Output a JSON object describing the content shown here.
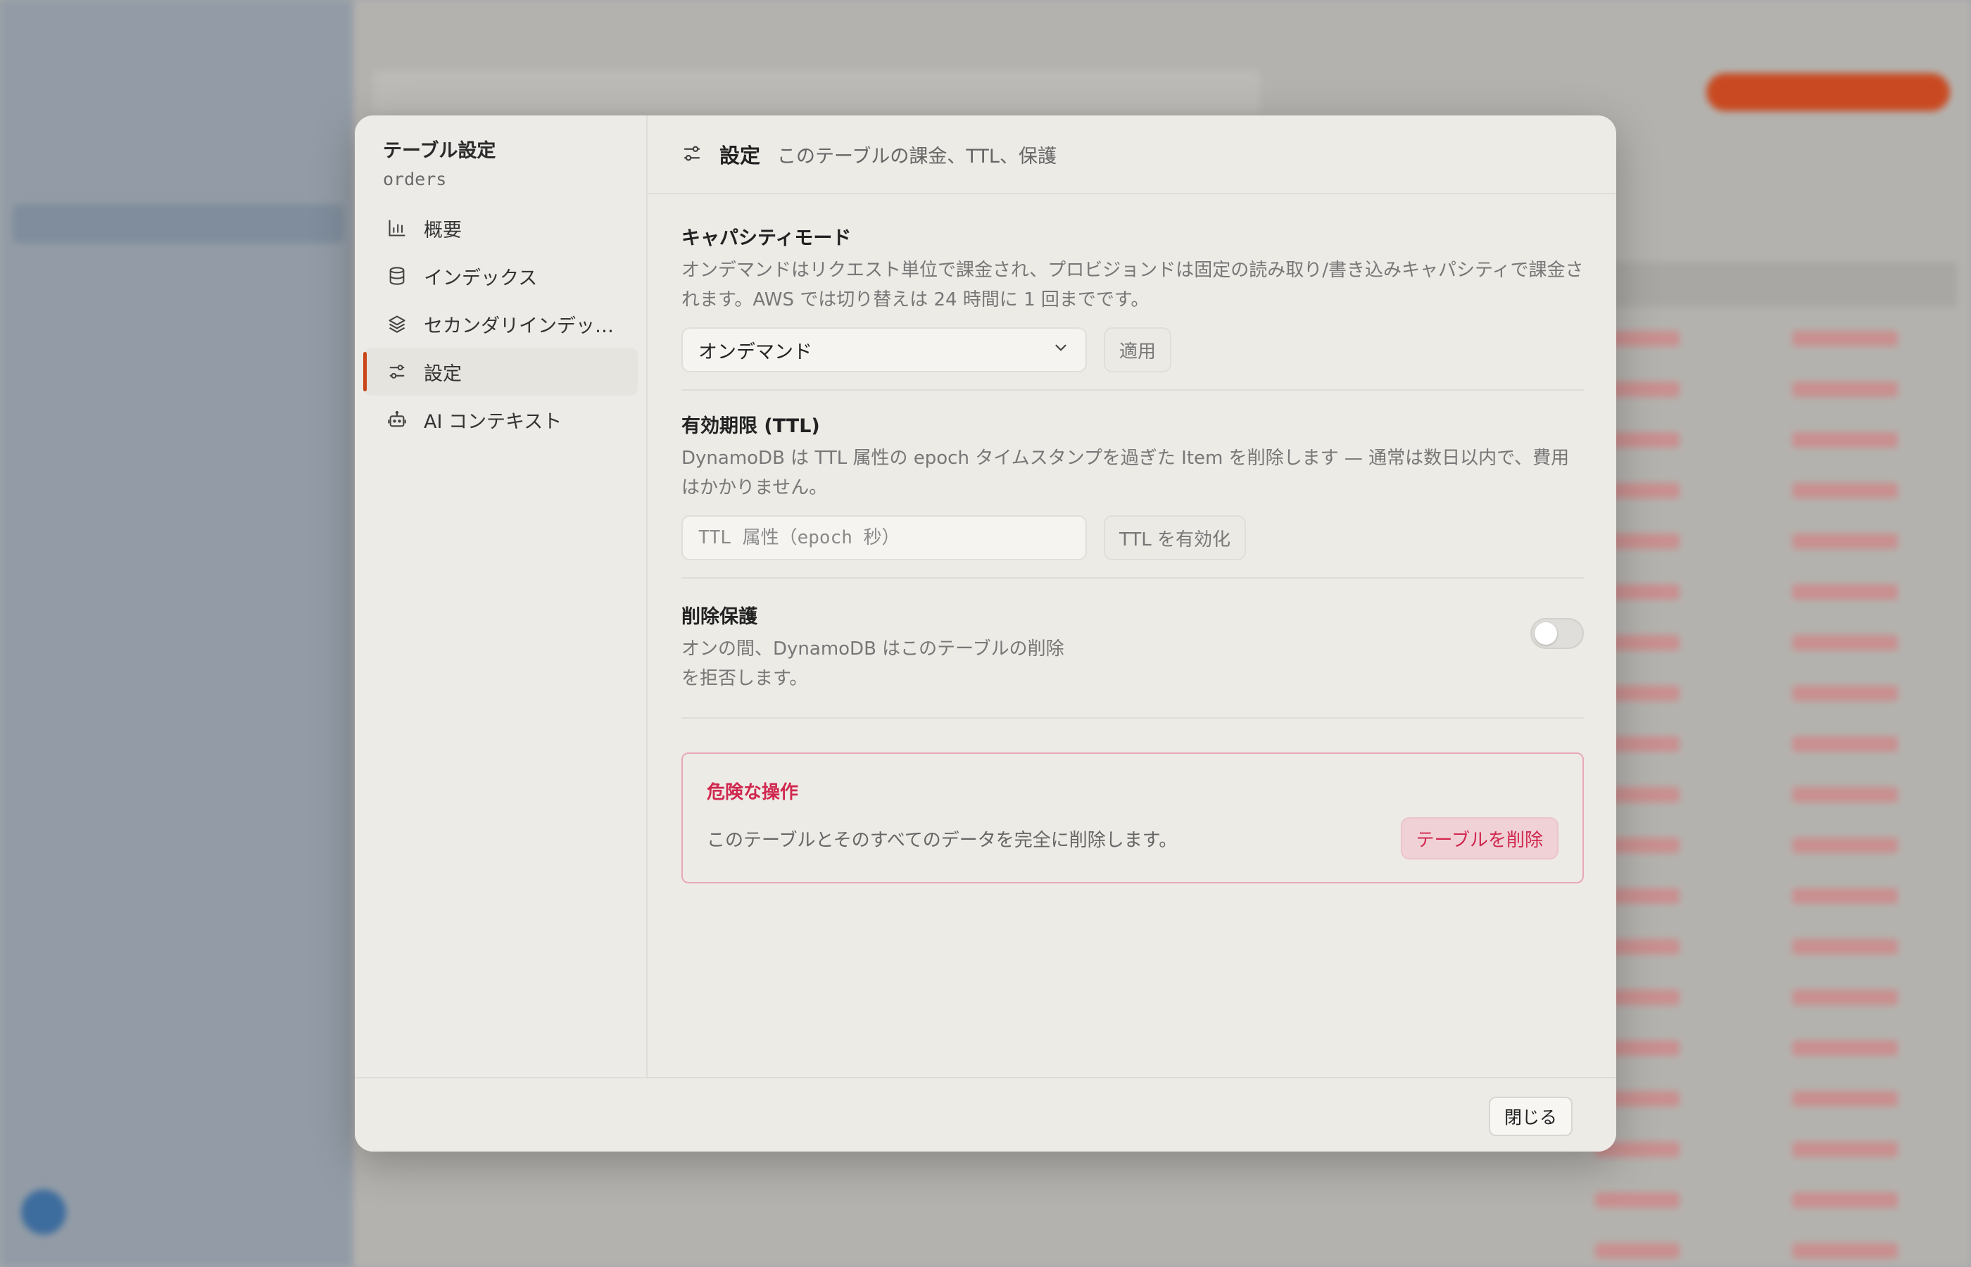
{
  "modal": {
    "sidebar": {
      "title": "テーブル設定",
      "table_name": "orders",
      "items": [
        {
          "label": "概要",
          "icon": "bar-chart-icon"
        },
        {
          "label": "インデックス",
          "icon": "database-icon"
        },
        {
          "label": "セカンダリインデックス",
          "icon": "layers-icon"
        },
        {
          "label": "設定",
          "icon": "sliders-icon",
          "active": true
        },
        {
          "label": "AI コンテキスト",
          "icon": "robot-icon"
        }
      ]
    },
    "header": {
      "title": "設定",
      "description": "このテーブルの課金、TTL、保護"
    },
    "capacity": {
      "title": "キャパシティモード",
      "description": "オンデマンドはリクエスト単位で課金され、プロビジョンドは固定の読み取り/書き込みキャパシティで課金されます。AWS では切り替えは 24 時間に 1 回までです。",
      "selected": "オンデマンド",
      "apply_label": "適用"
    },
    "ttl": {
      "title": "有効期限 (TTL)",
      "description": "DynamoDB は TTL 属性の epoch タイムスタンプを過ぎた Item を削除します — 通常は数日以内で、費用はかかりません。",
      "placeholder": "TTL 属性（epoch 秒）",
      "enable_label": "TTL を有効化"
    },
    "protection": {
      "title": "削除保護",
      "description": "オンの間、DynamoDB はこのテーブルの削除を拒否します。",
      "enabled": false
    },
    "danger": {
      "title": "危険な操作",
      "description": "このテーブルとそのすべてのデータを完全に削除します。",
      "delete_label": "テーブルを削除"
    },
    "footer": {
      "close_label": "閉じる"
    }
  },
  "colors": {
    "accent": "#c9461a",
    "danger": "#d0284f",
    "modal_bg": "#edebe6"
  }
}
